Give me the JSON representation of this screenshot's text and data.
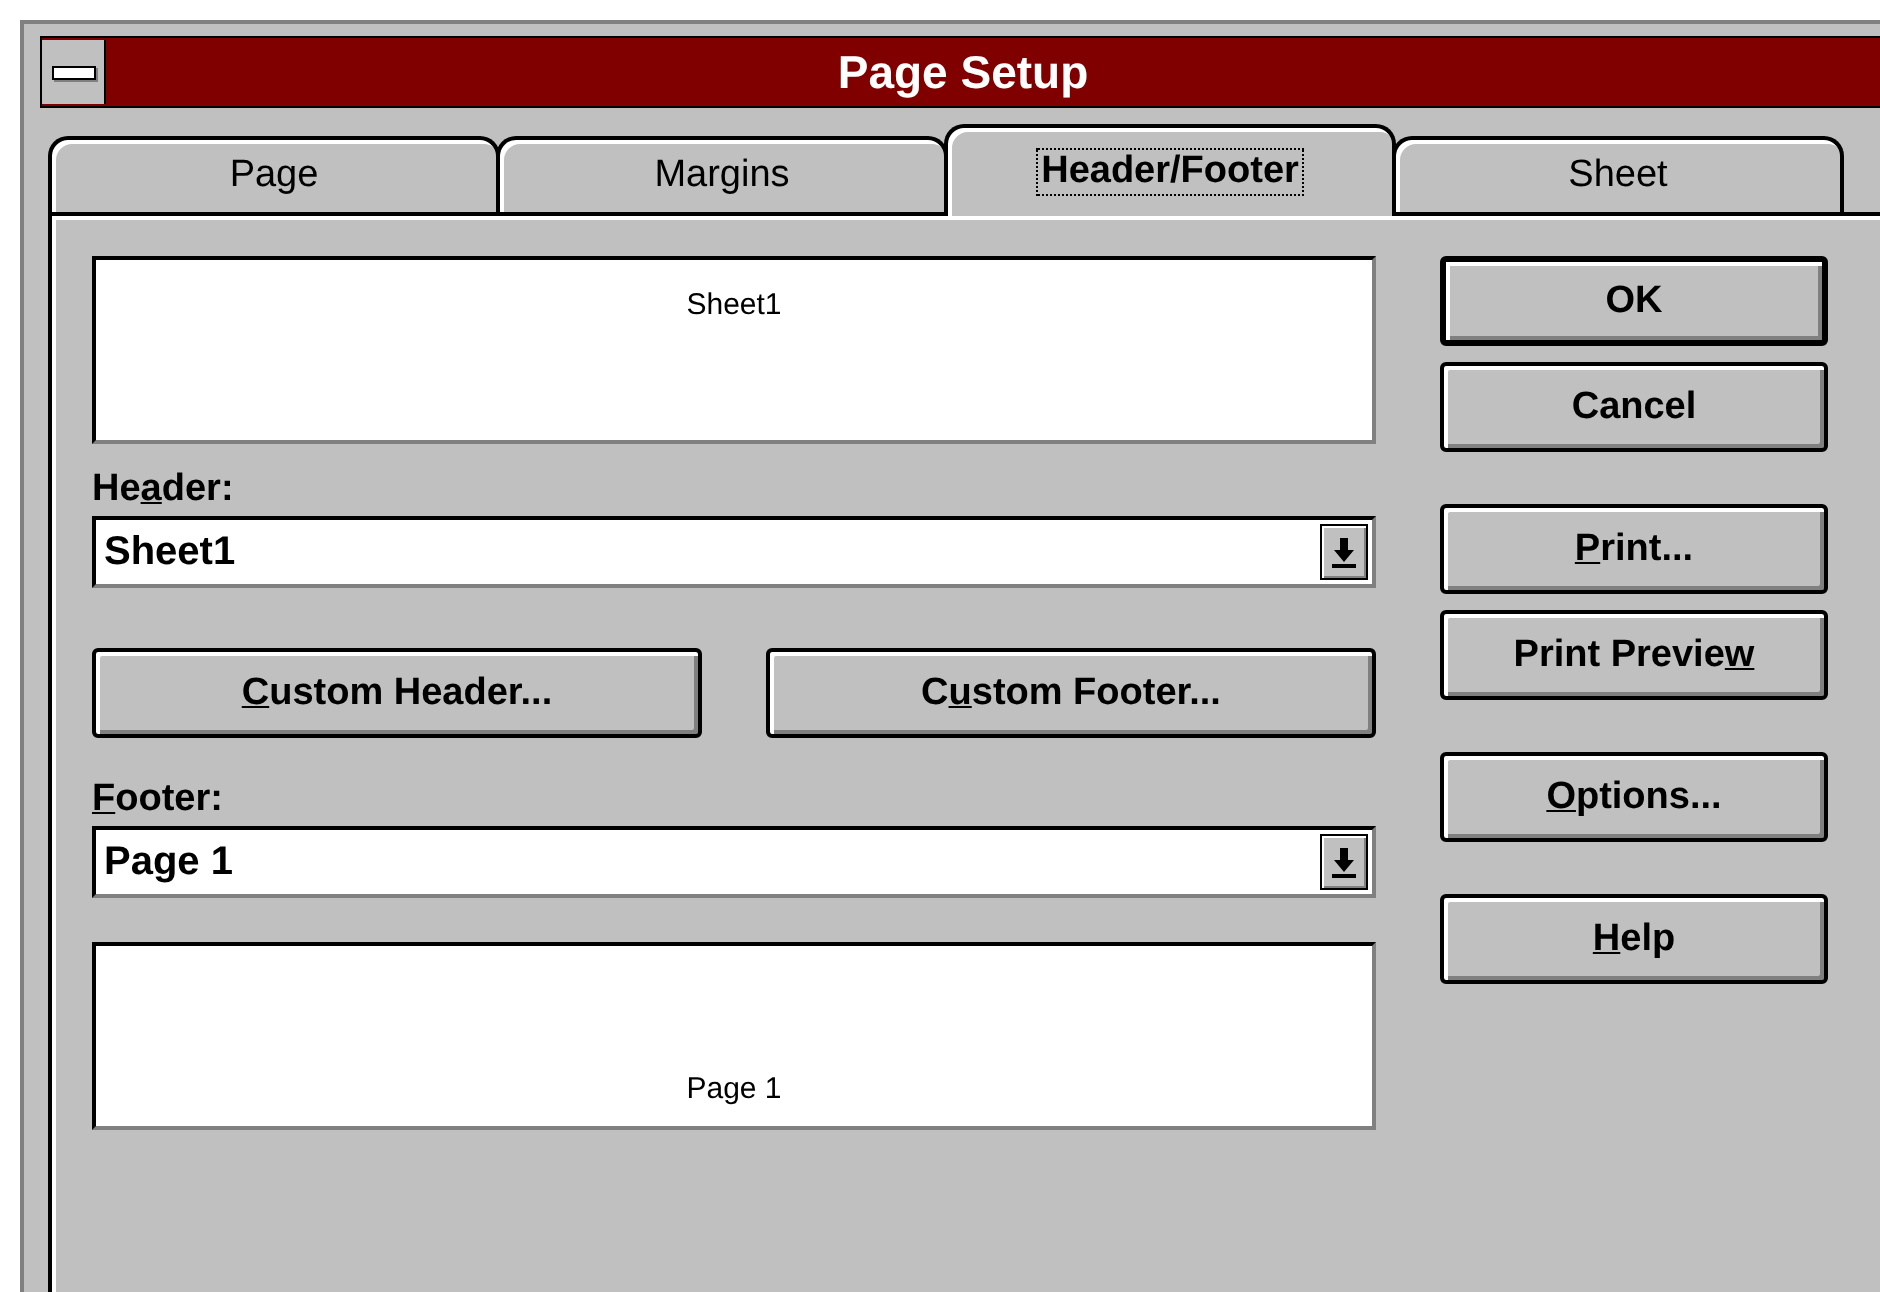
{
  "window": {
    "title": "Page Setup"
  },
  "tabs": [
    {
      "label": "Page",
      "selected": false
    },
    {
      "label": "Margins",
      "selected": false
    },
    {
      "label": "Header/Footer",
      "selected": true
    },
    {
      "label": "Sheet",
      "selected": false
    }
  ],
  "header_preview": {
    "text": "Sheet1"
  },
  "header": {
    "label": {
      "before": "He",
      "key": "a",
      "after": "der:"
    },
    "value": "Sheet1"
  },
  "custom_buttons": [
    {
      "label": {
        "key": "C",
        "after": "ustom Header..."
      }
    },
    {
      "label": {
        "before": "C",
        "key": "u",
        "after": "stom Footer..."
      }
    }
  ],
  "footer": {
    "label": {
      "key": "F",
      "after": "ooter:"
    },
    "value": "Page 1"
  },
  "footer_preview": {
    "text": "Page 1"
  },
  "button_groups": [
    [
      {
        "label": "OK",
        "default": true
      },
      {
        "label": "Cancel",
        "default": false
      }
    ],
    [
      {
        "label": {
          "key": "P",
          "after": "rint..."
        },
        "default": false
      },
      {
        "label": {
          "before": "Print Previe",
          "key": "w"
        },
        "default": false
      }
    ],
    [
      {
        "label": {
          "key": "O",
          "after": "ptions..."
        },
        "default": false
      }
    ],
    [
      {
        "label": {
          "key": "H",
          "after": "elp"
        },
        "default": false
      }
    ]
  ]
}
